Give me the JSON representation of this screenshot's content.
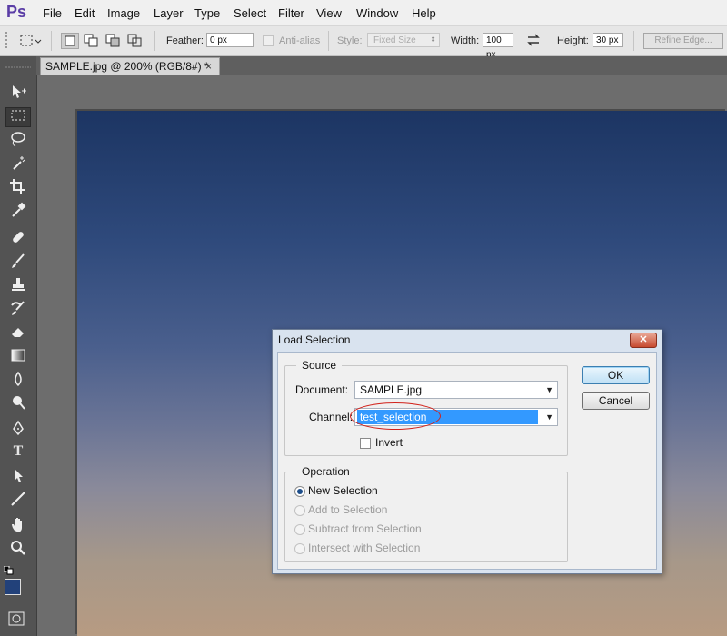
{
  "app": {
    "logo": "Ps"
  },
  "menu": [
    "File",
    "Edit",
    "Image",
    "Layer",
    "Type",
    "Select",
    "Filter",
    "View",
    "Window",
    "Help"
  ],
  "options": {
    "feather_label": "Feather:",
    "feather_value": "0 px",
    "antialias_label": "Anti-alias",
    "style_label": "Style:",
    "style_value": "Fixed Size",
    "width_label": "Width:",
    "width_value": "100 px",
    "height_label": "Height:",
    "height_value": "30 px",
    "refine_edge": "Refine Edge..."
  },
  "document_tab": {
    "title": "SAMPLE.jpg @ 200% (RGB/8#) *",
    "close": "×"
  },
  "colors": {
    "foreground": "#22417a",
    "background": "#ffffff",
    "accent": "#3399ff"
  },
  "tools": [
    "move-tool",
    "rectangular-marquee-tool",
    "lasso-tool",
    "magic-wand-tool",
    "crop-tool",
    "eyedropper-tool",
    "healing-brush-tool",
    "brush-tool",
    "clone-stamp-tool",
    "history-brush-tool",
    "eraser-tool",
    "gradient-tool",
    "blur-tool",
    "dodge-tool",
    "pen-tool",
    "type-tool",
    "path-selection-tool",
    "line-tool",
    "hand-tool",
    "zoom-tool"
  ],
  "dialog": {
    "title": "Load Selection",
    "close": "✕",
    "source_legend": "Source",
    "document_label": "Document:",
    "document_value": "SAMPLE.jpg",
    "channel_label": "Channel:",
    "channel_value": "test_selection",
    "invert_label": "Invert",
    "operation_legend": "Operation",
    "operations": [
      "New Selection",
      "Add to Selection",
      "Subtract from Selection",
      "Intersect with Selection"
    ],
    "ok_label": "OK",
    "cancel_label": "Cancel"
  }
}
